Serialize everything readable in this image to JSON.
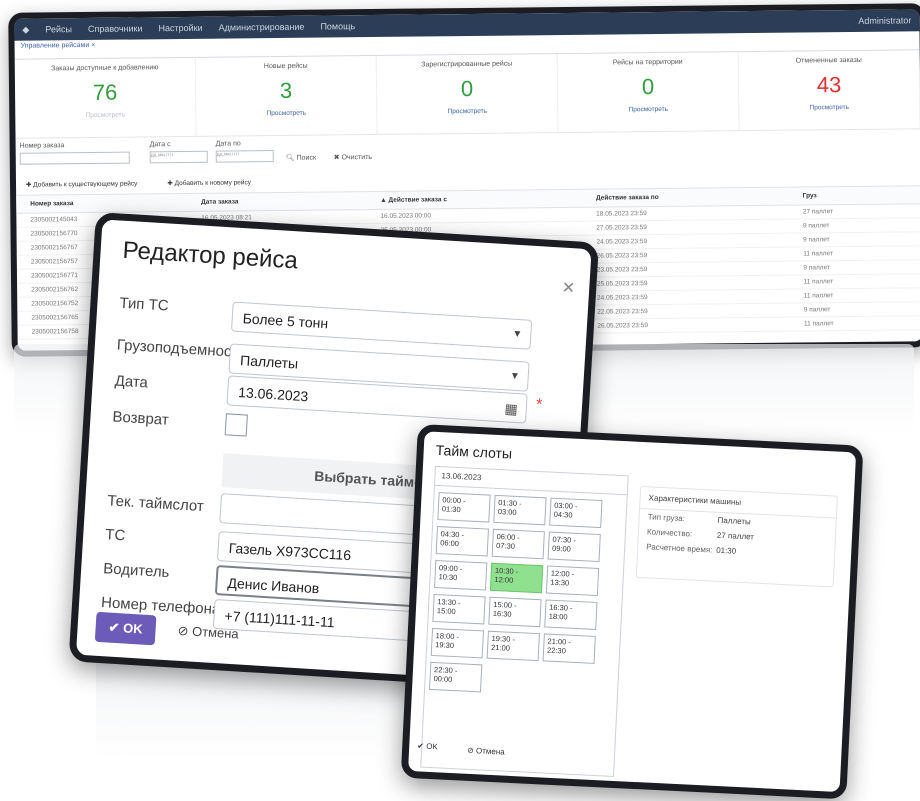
{
  "app": {
    "menu": [
      "Рейсы",
      "Справочники",
      "Настройки",
      "Администрирование",
      "Помощь"
    ],
    "user": "Administrator",
    "tab": "Управление рейсами  ×"
  },
  "stats": [
    {
      "label": "Заказы доступные к добавлению",
      "value": "76",
      "link": "Просмотреть",
      "color": "#2e9e3a"
    },
    {
      "label": "Новые рейсы",
      "value": "3",
      "link": "Просмотреть",
      "color": "#2e9e3a"
    },
    {
      "label": "Зарегистрированные рейсы",
      "value": "0",
      "link": "Просмотреть",
      "color": "#2e9e3a"
    },
    {
      "label": "Рейсы на территории",
      "value": "0",
      "link": "Просмотреть",
      "color": "#2e9e3a"
    },
    {
      "label": "Отмененные заказы",
      "value": "43",
      "link": "Просмотреть",
      "color": "#e03131"
    }
  ],
  "filters": {
    "order_label": "Номер заказа",
    "date_from_label": "Дата с",
    "date_to_label": "Дата по",
    "date_placeholder": "дд.мм.гггг",
    "search": "Поиск",
    "clear": "Очистить"
  },
  "actions": {
    "add_existing": "Добавить к существующему рейсу",
    "add_new": "Добавить к новому рейсу"
  },
  "table": {
    "columns": [
      "Номер заказа",
      "Дата заказа",
      "Действие заказа с",
      "Действие заказа по",
      "Груз"
    ],
    "rows": [
      [
        "2305002145043",
        "16.05.2023 08:21",
        "16.05.2023 00:00",
        "18.05.2023 23:59",
        "27 паллет"
      ],
      [
        "2305002156770",
        "18.05.2023 16:30",
        "25.05.2023 00:00",
        "27.05.2023 23:59",
        "9 паллет"
      ],
      [
        "2305002156767",
        "",
        "",
        "24.05.2023 23:59",
        "9 паллет"
      ],
      [
        "2305002156757",
        "",
        "",
        "26.05.2023 23:59",
        "11 паллет"
      ],
      [
        "2305002156771",
        "",
        "",
        "23.05.2023 23:59",
        "9 паллет"
      ],
      [
        "2305002156762",
        "",
        "",
        "25.05.2023 23:59",
        "11 паллет"
      ],
      [
        "2305002156752",
        "",
        "",
        "24.05.2023 23:59",
        "11 паллет"
      ],
      [
        "2305002156765",
        "",
        "",
        "22.05.2023 23:59",
        "9 паллет"
      ],
      [
        "2305002156758",
        "",
        "",
        "26.05.2023 23:59",
        "11 паллет"
      ]
    ]
  },
  "editor": {
    "title": "Редактор рейса",
    "vehicle_type_label": "Тип ТС",
    "vehicle_type_value": "Более 5 тонн",
    "capacity_label": "Грузоподъемность",
    "capacity_value": "Паллеты",
    "date_label": "Дата",
    "date_value": "13.06.2023",
    "return_label": "Возврат",
    "choose_slot": "Выбрать тайм-сло",
    "current_slot_label": "Тек. таймслот",
    "vehicle_label": "ТС",
    "vehicle_value": "Газель Х973СС116",
    "driver_label": "Водитель",
    "driver_value": "Денис Иванов",
    "phone_label": "Номер телефона",
    "phone_value": "+7 (111)111-11-11",
    "ok": "OK",
    "cancel": "Отмена"
  },
  "timeslots": {
    "title": "Тайм слоты",
    "date": "13.06.2023",
    "slots": [
      "00:00 - 01:30",
      "01:30 - 03:00",
      "03:00 - 04:30",
      "04:30 - 06:00",
      "06:00 - 07:30",
      "07:30 - 09:00",
      "09:00 - 10:30",
      "10:30 - 12:00",
      "12:00 - 13:30",
      "13:30 - 15:00",
      "15:00 - 16:30",
      "16:30 - 18:00",
      "18:00 - 19:30",
      "19:30 - 21:00",
      "21:00 - 22:30",
      "22:30 - 00:00"
    ],
    "selected": "10:30 - 12:00",
    "details_title": "Характеристики машины",
    "cargo_type_label": "Тип груза:",
    "cargo_type_value": "Паллеты",
    "quantity_label": "Количество:",
    "quantity_value": "27 паллет",
    "time_label": "Расчетное время:",
    "time_value": "01:30",
    "ok": "OK",
    "cancel": "Отмена"
  }
}
